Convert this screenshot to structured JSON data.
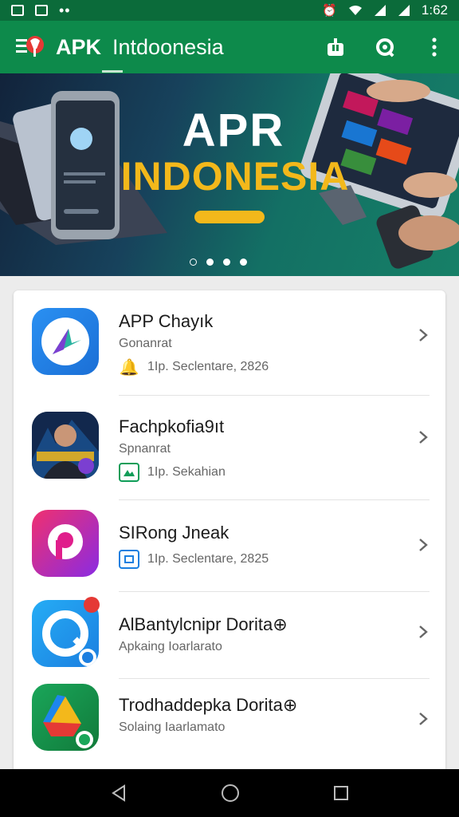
{
  "status_bar": {
    "time": "1:62"
  },
  "app_bar": {
    "title_brand": "APK",
    "title_rest": "Intdoonesia"
  },
  "banner": {
    "title": "APR",
    "subtitle": "INDONESIA",
    "pages": 4,
    "active_page": 1
  },
  "apps": [
    {
      "name": "APP Chayık",
      "developer": "Gonanrat",
      "meta": "1Ip. Seclentare, 2826",
      "meta_icon": "badge-icon",
      "icon": "app-gradient-logo-icon",
      "colors": [
        "#1e86ee",
        "#2a6fd8"
      ]
    },
    {
      "name": "Fachpkofia9ıt",
      "developer": "Spnanrat",
      "meta": "1Ip. Sekahian",
      "meta_icon": "image-icon",
      "icon": "person-thumbnail-icon",
      "colors": [
        "#0b1a3a",
        "#183a6b"
      ]
    },
    {
      "name": "SIRong Jneak",
      "developer": "",
      "meta": "1Ip. Seclentare, 2825",
      "meta_icon": "device-icon",
      "icon": "pink-p-logo-icon",
      "colors": [
        "#e01e8b",
        "#8a2be2"
      ]
    },
    {
      "name": "AlBantylcnipr Dorita⊕",
      "developer": "Apkaing Ioarlarato",
      "meta": "",
      "meta_icon": "",
      "icon": "blue-q-logo-icon",
      "colors": [
        "#1aa0f0",
        "#1c7fe0"
      ]
    },
    {
      "name": "Trodhaddepka Dorita⊕",
      "developer": "Solaing Iaarlamato",
      "meta": "",
      "meta_icon": "",
      "icon": "drive-logo-icon",
      "colors": [
        "#1a9b4a",
        "#137a3a"
      ]
    }
  ],
  "colors": {
    "primary": "#0d8a4b",
    "status": "#0b6b3a",
    "accent": "#f3b81b"
  }
}
